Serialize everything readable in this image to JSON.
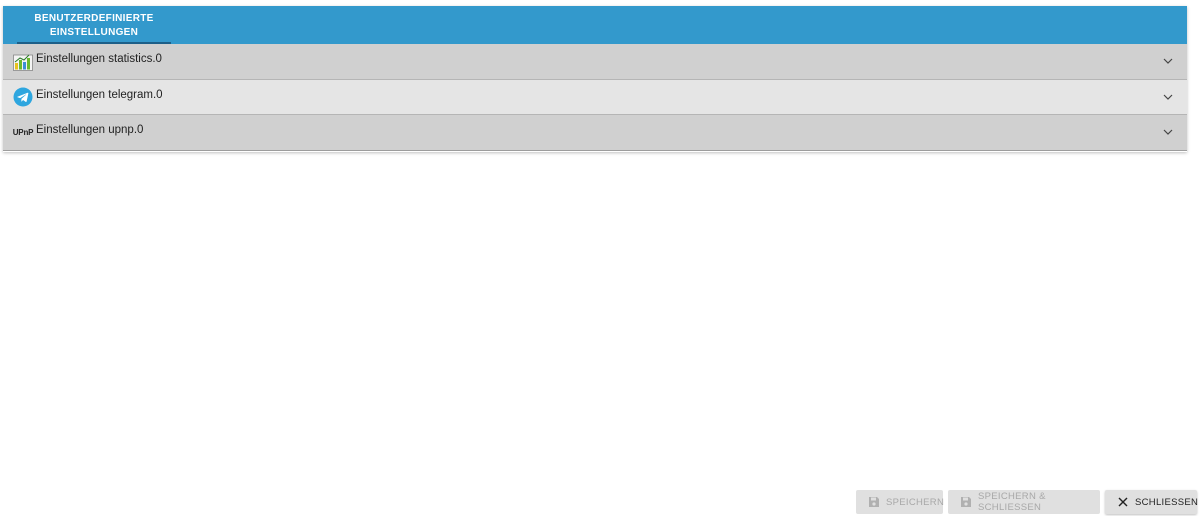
{
  "tabs": [
    {
      "label": "BENUTZERDEFINIERTE EINSTELLUNGEN",
      "line1": "BENUTZERDEFINIERTE",
      "line2": "EINSTELLUNGEN"
    }
  ],
  "panels": [
    {
      "label": "Einstellungen statistics.0",
      "icon": "statistics-chart-icon"
    },
    {
      "label": "Einstellungen telegram.0",
      "icon": "telegram-icon"
    },
    {
      "label": "Einstellungen upnp.0",
      "icon": "upnp-icon",
      "icon_text": "UPnP"
    }
  ],
  "buttons": {
    "save": "SPEICHERN",
    "save_close": "SPEICHERN & SCHLIESSEN",
    "close": "SCHLIESSEN"
  },
  "colors": {
    "tab_bar": "#3399cc",
    "telegram": "#2ea6df"
  }
}
